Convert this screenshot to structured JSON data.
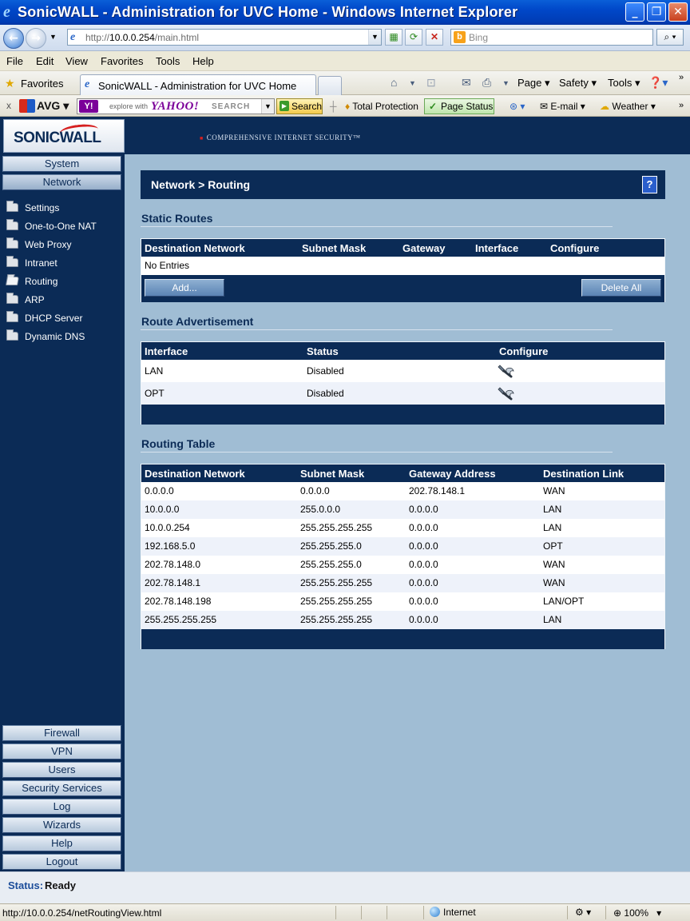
{
  "window": {
    "title": "SonicWALL - Administration for UVC Home - Windows Internet Explorer"
  },
  "address_bar": {
    "url_prefix": "http://",
    "url_host": "10.0.0.254",
    "url_path": "/main.html",
    "search_placeholder": "Bing"
  },
  "menu": [
    "File",
    "Edit",
    "View",
    "Favorites",
    "Tools",
    "Help"
  ],
  "favorites_bar": {
    "favorites_label": "Favorites",
    "tab_title": "SonicWALL - Administration for UVC Home",
    "commands": [
      "Page",
      "Safety",
      "Tools"
    ]
  },
  "avg_toolbar": {
    "avg_label": "AVG",
    "explore_with": "explore with",
    "yahoo_logo": "YAHOO!",
    "search_word": "SEARCH",
    "search_button": "Search",
    "total_protection": "Total Protection",
    "page_status": "Page Status",
    "email": "E-mail",
    "weather": "Weather"
  },
  "brand": {
    "logo": "SONICWALL",
    "tagline": "COMPREHENSIVE INTERNET SECURITY™"
  },
  "sidebar": {
    "top_buttons": [
      "System",
      "Network"
    ],
    "network_items": [
      "Settings",
      "One-to-One NAT",
      "Web Proxy",
      "Intranet",
      "Routing",
      "ARP",
      "DHCP Server",
      "Dynamic DNS"
    ],
    "active_item": "Routing",
    "bottom_buttons": [
      "Firewall",
      "VPN",
      "Users",
      "Security Services",
      "Log",
      "Wizards",
      "Help",
      "Logout"
    ]
  },
  "page": {
    "title": "Network > Routing",
    "help_label": "?"
  },
  "static_routes": {
    "heading": "Static Routes",
    "columns": [
      "Destination Network",
      "Subnet Mask",
      "Gateway",
      "Interface",
      "Configure"
    ],
    "empty_text": "No Entries",
    "add_button": "Add...",
    "delete_all_button": "Delete All"
  },
  "route_advertisement": {
    "heading": "Route Advertisement",
    "columns": [
      "Interface",
      "Status",
      "Configure"
    ],
    "rows": [
      {
        "interface": "LAN",
        "status": "Disabled"
      },
      {
        "interface": "OPT",
        "status": "Disabled"
      }
    ]
  },
  "routing_table": {
    "heading": "Routing Table",
    "columns": [
      "Destination Network",
      "Subnet Mask",
      "Gateway Address",
      "Destination Link"
    ],
    "rows": [
      [
        "0.0.0.0",
        "0.0.0.0",
        "202.78.148.1",
        "WAN"
      ],
      [
        "10.0.0.0",
        "255.0.0.0",
        "0.0.0.0",
        "LAN"
      ],
      [
        "10.0.0.254",
        "255.255.255.255",
        "0.0.0.0",
        "LAN"
      ],
      [
        "192.168.5.0",
        "255.255.255.0",
        "0.0.0.0",
        "OPT"
      ],
      [
        "202.78.148.0",
        "255.255.255.0",
        "0.0.0.0",
        "WAN"
      ],
      [
        "202.78.148.1",
        "255.255.255.255",
        "0.0.0.0",
        "WAN"
      ],
      [
        "202.78.148.198",
        "255.255.255.255",
        "0.0.0.0",
        "LAN/OPT"
      ],
      [
        "255.255.255.255",
        "255.255.255.255",
        "0.0.0.0",
        "LAN"
      ]
    ]
  },
  "status": {
    "label": "Status:",
    "value": "Ready"
  },
  "ie_status": {
    "hover_url": "http://10.0.0.254/netRoutingView.html",
    "zone": "Internet",
    "zoom": "100%"
  }
}
